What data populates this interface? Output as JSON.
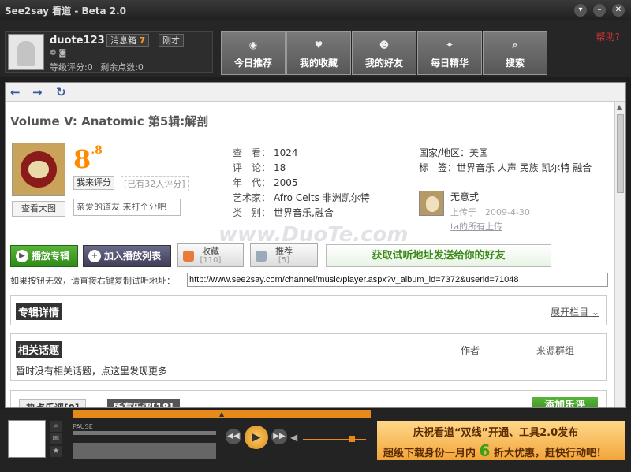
{
  "window": {
    "title": "See2say 看道 - Beta 2.0"
  },
  "header": {
    "username": "duote123",
    "inbox_label": "消息箱",
    "inbox_count": "7",
    "just_now": "刚才",
    "level_text": "等级评分:0",
    "points_text": "剩余点数:0",
    "help": "帮助?"
  },
  "nav": {
    "tabs": [
      {
        "label": "今日推荐",
        "icon": "disc-icon"
      },
      {
        "label": "我的收藏",
        "icon": "heart-icon"
      },
      {
        "label": "我的好友",
        "icon": "friends-icon"
      },
      {
        "label": "每日精华",
        "icon": "lightbulb-icon"
      },
      {
        "label": "搜索",
        "icon": "search-icon"
      }
    ]
  },
  "album": {
    "title": "Volume V: Anatomic 第5辑:解剖",
    "view_large": "查看大图",
    "score_int": "8",
    "score_dec": ".8",
    "rate_button": "我来评分",
    "rate_count": "[已有32人评分]",
    "comment_placeholder": "亲爱的道友 来打个分吧",
    "meta": [
      {
        "k": "查　看：",
        "v": "1024"
      },
      {
        "k": "评　论：",
        "v": "18"
      },
      {
        "k": "年　代：",
        "v": "2005"
      },
      {
        "k": "艺术家：",
        "v": "Afro Celts 非洲凯尔特"
      },
      {
        "k": "类　别：",
        "v": "世界音乐,融合"
      }
    ],
    "region_label": "国家/地区：",
    "region": "美国",
    "tags_label": "标　签：",
    "tags": "世界音乐 人声 民族 凯尔特 融合",
    "uploader": "无意式",
    "uploaded_at": "上传于　2009-4-30",
    "all_uploads": "ta的所有上传"
  },
  "watermark": "www.DuoTe.com",
  "actions": {
    "play": "播放专辑",
    "add_list": "加入播放列表",
    "fav_label": "收藏",
    "fav_count": "[110]",
    "rec_label": "推荐",
    "rec_count": "[5]",
    "send": "获取试听地址发送给你的好友"
  },
  "url": {
    "hint": "如果按钮无效，请直接右键复制试听地址：",
    "value": "http://www.see2say.com/channel/music/player.aspx?v_album_id=7372&userid=71048"
  },
  "details": {
    "heading": "专辑详情",
    "expand": "展开栏目"
  },
  "topics": {
    "heading": "相关话题",
    "col_author": "作者",
    "col_group": "来源群组",
    "empty": "暂时没有相关话题，点这里发现更多"
  },
  "music": {
    "tab1": "热点乐评[0]",
    "tab2": "所有乐评[18]",
    "add": "添加乐评"
  },
  "player": {
    "state": "PAUSE",
    "ad_line1": "庆祝看道“双线”开通、工具2.0发布",
    "ad_line2a": "超级下载身份一月内",
    "ad_six": "6",
    "ad_line2b": "折大优惠，赶快行动吧！"
  },
  "colors": {
    "accent": "#ff8a00",
    "green": "#3a8a1a"
  }
}
